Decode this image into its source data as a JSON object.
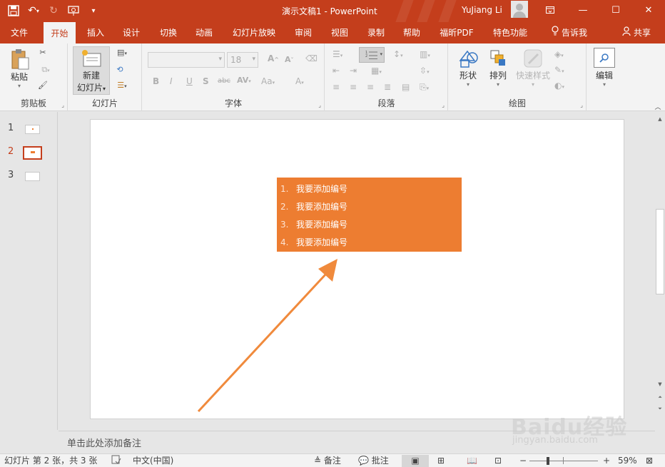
{
  "window": {
    "title": "演示文稿1  -  PowerPoint",
    "user_name": "YuJiang Li"
  },
  "tabs": [
    {
      "label": "文件"
    },
    {
      "label": "开始"
    },
    {
      "label": "插入"
    },
    {
      "label": "设计"
    },
    {
      "label": "切换"
    },
    {
      "label": "动画"
    },
    {
      "label": "幻灯片放映"
    },
    {
      "label": "审阅"
    },
    {
      "label": "视图"
    },
    {
      "label": "录制"
    },
    {
      "label": "帮助"
    },
    {
      "label": "福昕PDF"
    },
    {
      "label": "特色功能"
    },
    {
      "label": "告诉我"
    },
    {
      "label": "共享"
    }
  ],
  "ribbon": {
    "clipboard": {
      "label": "剪贴板",
      "paste": "粘贴"
    },
    "slides": {
      "label": "幻灯片",
      "new_slide_line1": "新建",
      "new_slide_line2": "幻灯片"
    },
    "font": {
      "label": "字体",
      "size": "18"
    },
    "paragraph": {
      "label": "段落"
    },
    "drawing": {
      "label": "绘图",
      "shapes": "形状",
      "arrange": "排列",
      "quick_styles": "快速样式"
    },
    "editing": {
      "label": "编辑"
    }
  },
  "thumbnails": [
    {
      "num": "1"
    },
    {
      "num": "2"
    },
    {
      "num": "3"
    }
  ],
  "slide": {
    "list_items": [
      {
        "num": "1.",
        "text": "我要添加编号"
      },
      {
        "num": "2.",
        "text": "我要添加编号"
      },
      {
        "num": "3.",
        "text": "我要添加编号"
      },
      {
        "num": "4.",
        "text": "我要添加编号"
      }
    ]
  },
  "notes": {
    "placeholder": "单击此处添加备注"
  },
  "status": {
    "slide_info": "幻灯片 第 2 张，共 3 张",
    "language": "中文(中国)",
    "notes": "备注",
    "comments": "批注",
    "zoom": "59%"
  },
  "watermark": {
    "brand": "Baidu经验",
    "url": "jingyan.baidu.com"
  },
  "colors": {
    "accent": "#c43e1c",
    "shape_fill": "#ed7d31"
  }
}
